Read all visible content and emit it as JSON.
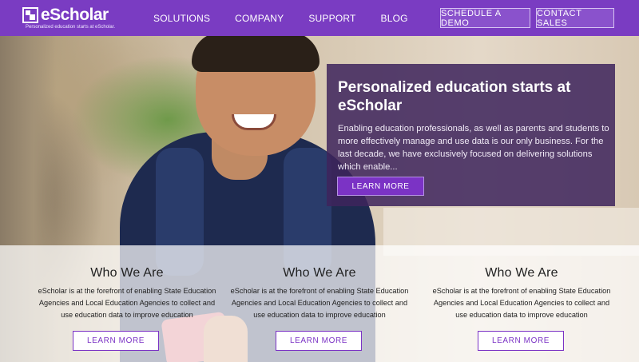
{
  "brand": {
    "name": "eScholar",
    "tagline": "Personalized education starts at eScholar.",
    "accent": "#7a3cc2",
    "panel": "#3e245c"
  },
  "nav": {
    "items": [
      "SOLUTIONS",
      "COMPANY",
      "SUPPORT",
      "BLOG"
    ],
    "schedule_demo": "SCHEDULE A DEMO",
    "contact_sales": "CONTACT SALES"
  },
  "hero": {
    "title": "Personalized education starts at eScholar",
    "text": "Enabling education professionals, as well as parents and students to more effectively manage and use data is our only business. For the last decade, we have exclusively focused on delivering solutions which enable...",
    "button": "LEARN MORE"
  },
  "columns": [
    {
      "heading": "Who We Are",
      "text": "eScholar is at the forefront of enabling State Education Agencies and Local Education Agencies to collect and use education data to improve education",
      "button": "LEARN MORE"
    },
    {
      "heading": "Who We Are",
      "text": "eScholar is at the forefront of enabling State Education Agencies and Local Education Agencies to collect and use education data to improve education",
      "button": "LEARN MORE"
    },
    {
      "heading": "Who We Are",
      "text": "eScholar is at the forefront of enabling State Education Agencies and Local Education Agencies to collect and use education data to improve education",
      "button": "LEARN MORE"
    }
  ]
}
